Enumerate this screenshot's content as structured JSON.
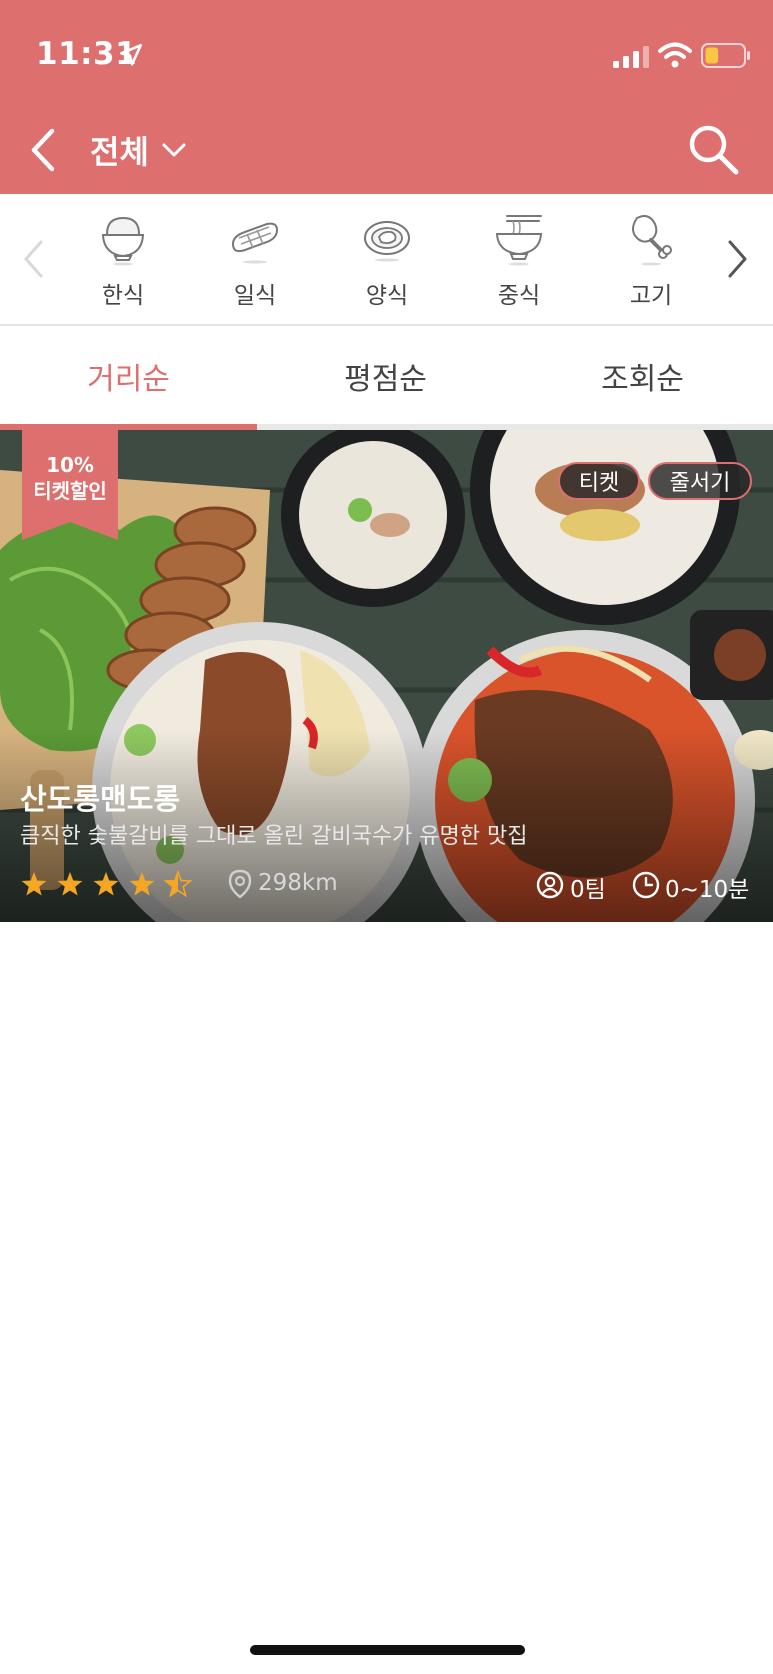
{
  "status_bar": {
    "time": "11:31",
    "battery_level": 0.35,
    "battery_color": "#f7c744"
  },
  "nav": {
    "title": "전체"
  },
  "categories": [
    {
      "label": "한식",
      "icon": "rice-bowl-icon"
    },
    {
      "label": "일식",
      "icon": "sushi-icon"
    },
    {
      "label": "양식",
      "icon": "steak-plate-icon"
    },
    {
      "label": "중식",
      "icon": "noodle-bowl-icon"
    },
    {
      "label": "고기",
      "icon": "drumstick-icon"
    }
  ],
  "sort_tabs": [
    {
      "label": "거리순",
      "active": true
    },
    {
      "label": "평점순",
      "active": false
    },
    {
      "label": "조회순",
      "active": false
    }
  ],
  "restaurant": {
    "discount_line1": "10%",
    "discount_line2": "티켓할인",
    "tags": [
      "티켓",
      "줄서기"
    ],
    "name": "산도롱맨도롱",
    "description": "큼직한 숯불갈비를 그대로 올린 갈비국수가 유명한 맛집",
    "rating": 4.5,
    "distance": "298km",
    "team_count": "0팀",
    "wait_time": "0~10분"
  },
  "colors": {
    "accent": "#dd6f6e",
    "star": "#f5a623"
  }
}
